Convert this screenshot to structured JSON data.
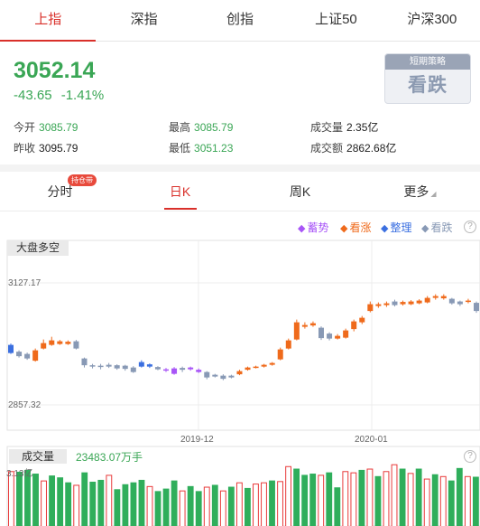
{
  "market_tabs": [
    "上指",
    "深指",
    "创指",
    "上证50",
    "沪深300"
  ],
  "quote": {
    "price": "3052.14",
    "change": "-43.65",
    "change_pct": "-1.41%",
    "open_label": "今开",
    "open": "3085.79",
    "prev_close_label": "昨收",
    "prev_close": "3095.79",
    "high_label": "最高",
    "high": "3085.79",
    "low_label": "最低",
    "low": "3051.23",
    "volume_label": "成交量",
    "volume": "2.35亿",
    "turnover_label": "成交额",
    "turnover": "2862.68亿"
  },
  "strategy": {
    "title": "短期策略",
    "value": "看跌"
  },
  "chart_tabs": {
    "items": [
      "分时",
      "日K",
      "周K",
      "更多"
    ],
    "badge": "持仓带"
  },
  "legend": [
    {
      "label": "蓄势",
      "color": "#a855f7"
    },
    {
      "label": "看涨",
      "color": "#ef6a1b"
    },
    {
      "label": "整理",
      "color": "#3b6fe0"
    },
    {
      "label": "看跌",
      "color": "#8899b5"
    }
  ],
  "kline": {
    "panel_label": "大盘多空",
    "y_top_label": "3127.17",
    "y_bottom_label": "2857.32",
    "x_labels": [
      "2019-12",
      "2020-01"
    ]
  },
  "volume": {
    "title": "成交量",
    "value": "23483.07万手",
    "max_label": "3.13亿"
  },
  "chart_data": {
    "type": "candlestick",
    "ylim": [
      2857.32,
      3127.17
    ],
    "candles": [
      {
        "o": 2972,
        "c": 2990,
        "h": 2993,
        "l": 2970,
        "s": "z"
      },
      {
        "o": 2965,
        "c": 2975,
        "h": 2978,
        "l": 2962,
        "s": "d"
      },
      {
        "o": 2970,
        "c": 2960,
        "h": 2973,
        "l": 2957,
        "s": "d"
      },
      {
        "o": 2955,
        "c": 2978,
        "h": 2982,
        "l": 2953,
        "s": "k"
      },
      {
        "o": 2982,
        "c": 2994,
        "h": 3002,
        "l": 2980,
        "s": "k"
      },
      {
        "o": 2990,
        "c": 3000,
        "h": 3008,
        "l": 2988,
        "s": "k"
      },
      {
        "o": 2998,
        "c": 2992,
        "h": 3001,
        "l": 2990,
        "s": "k"
      },
      {
        "o": 2992,
        "c": 2997,
        "h": 3000,
        "l": 2990,
        "s": "k"
      },
      {
        "o": 2998,
        "c": 2982,
        "h": 3001,
        "l": 2980,
        "s": "d"
      },
      {
        "o": 2960,
        "c": 2945,
        "h": 2962,
        "l": 2940,
        "s": "d"
      },
      {
        "o": 2945,
        "c": 2942,
        "h": 2948,
        "l": 2938,
        "s": "d"
      },
      {
        "o": 2944,
        "c": 2941,
        "h": 2948,
        "l": 2936,
        "s": "d"
      },
      {
        "o": 2942,
        "c": 2946,
        "h": 2950,
        "l": 2939,
        "s": "d"
      },
      {
        "o": 2945,
        "c": 2938,
        "h": 2947,
        "l": 2935,
        "s": "d"
      },
      {
        "o": 2944,
        "c": 2937,
        "h": 2946,
        "l": 2933,
        "s": "d"
      },
      {
        "o": 2940,
        "c": 2930,
        "h": 2943,
        "l": 2928,
        "s": "d"
      },
      {
        "o": 2952,
        "c": 2942,
        "h": 2956,
        "l": 2940,
        "s": "z"
      },
      {
        "o": 2947,
        "c": 2942,
        "h": 2949,
        "l": 2939,
        "s": "z"
      },
      {
        "o": 2941,
        "c": 2936,
        "h": 2943,
        "l": 2934,
        "s": "d"
      },
      {
        "o": 2936,
        "c": 2933,
        "h": 2939,
        "l": 2930,
        "s": "x"
      },
      {
        "o": 2938,
        "c": 2926,
        "h": 2941,
        "l": 2924,
        "s": "x"
      },
      {
        "o": 2939,
        "c": 2935,
        "h": 2942,
        "l": 2930,
        "s": "d"
      },
      {
        "o": 2940,
        "c": 2936,
        "h": 2942,
        "l": 2933,
        "s": "x"
      },
      {
        "o": 2935,
        "c": 2930,
        "h": 2938,
        "l": 2928,
        "s": "x"
      },
      {
        "o": 2930,
        "c": 2918,
        "h": 2932,
        "l": 2914,
        "s": "d"
      },
      {
        "o": 2924,
        "c": 2920,
        "h": 2926,
        "l": 2918,
        "s": "d"
      },
      {
        "o": 2922,
        "c": 2915,
        "h": 2925,
        "l": 2912,
        "s": "d"
      },
      {
        "o": 2918,
        "c": 2922,
        "h": 2924,
        "l": 2916,
        "s": "d"
      },
      {
        "o": 2925,
        "c": 2932,
        "h": 2935,
        "l": 2923,
        "s": "k"
      },
      {
        "o": 2935,
        "c": 2940,
        "h": 2942,
        "l": 2933,
        "s": "k"
      },
      {
        "o": 2940,
        "c": 2942,
        "h": 2944,
        "l": 2938,
        "s": "k"
      },
      {
        "o": 2942,
        "c": 2946,
        "h": 2948,
        "l": 2940,
        "s": "k"
      },
      {
        "o": 2946,
        "c": 2950,
        "h": 2952,
        "l": 2944,
        "s": "k"
      },
      {
        "o": 2958,
        "c": 2980,
        "h": 2984,
        "l": 2956,
        "s": "k"
      },
      {
        "o": 2982,
        "c": 3000,
        "h": 3004,
        "l": 2980,
        "s": "k"
      },
      {
        "o": 3002,
        "c": 3040,
        "h": 3046,
        "l": 3000,
        "s": "k"
      },
      {
        "o": 3034,
        "c": 3030,
        "h": 3040,
        "l": 3026,
        "s": "k"
      },
      {
        "o": 3038,
        "c": 3033,
        "h": 3042,
        "l": 3030,
        "s": "k"
      },
      {
        "o": 3028,
        "c": 3005,
        "h": 3031,
        "l": 3001,
        "s": "d"
      },
      {
        "o": 3015,
        "c": 3004,
        "h": 3018,
        "l": 3000,
        "s": "d"
      },
      {
        "o": 3004,
        "c": 3010,
        "h": 3014,
        "l": 3002,
        "s": "k"
      },
      {
        "o": 3006,
        "c": 3022,
        "h": 3026,
        "l": 3004,
        "s": "k"
      },
      {
        "o": 3025,
        "c": 3042,
        "h": 3046,
        "l": 3020,
        "s": "k"
      },
      {
        "o": 3040,
        "c": 3050,
        "h": 3054,
        "l": 3036,
        "s": "k"
      },
      {
        "o": 3065,
        "c": 3080,
        "h": 3086,
        "l": 3062,
        "s": "k"
      },
      {
        "o": 3076,
        "c": 3080,
        "h": 3084,
        "l": 3072,
        "s": "k"
      },
      {
        "o": 3078,
        "c": 3082,
        "h": 3086,
        "l": 3074,
        "s": "k"
      },
      {
        "o": 3086,
        "c": 3078,
        "h": 3090,
        "l": 3075,
        "s": "d"
      },
      {
        "o": 3080,
        "c": 3085,
        "h": 3088,
        "l": 3077,
        "s": "k"
      },
      {
        "o": 3080,
        "c": 3086,
        "h": 3089,
        "l": 3078,
        "s": "k"
      },
      {
        "o": 3082,
        "c": 3088,
        "h": 3091,
        "l": 3080,
        "s": "k"
      },
      {
        "o": 3084,
        "c": 3094,
        "h": 3098,
        "l": 3082,
        "s": "k"
      },
      {
        "o": 3094,
        "c": 3098,
        "h": 3102,
        "l": 3090,
        "s": "k"
      },
      {
        "o": 3098,
        "c": 3093,
        "h": 3102,
        "l": 3090,
        "s": "k"
      },
      {
        "o": 3092,
        "c": 3082,
        "h": 3094,
        "l": 3079,
        "s": "d"
      },
      {
        "o": 3086,
        "c": 3080,
        "h": 3088,
        "l": 3076,
        "s": "d"
      },
      {
        "o": 3088,
        "c": 3085,
        "h": 3092,
        "l": 3082,
        "s": "k"
      },
      {
        "o": 3083,
        "c": 3065,
        "h": 3086,
        "l": 3061,
        "s": "d"
      }
    ],
    "volume": [
      {
        "v": 0.88,
        "d": 0
      },
      {
        "v": 0.87,
        "d": 1
      },
      {
        "v": 0.9,
        "d": 1
      },
      {
        "v": 0.84,
        "d": 1
      },
      {
        "v": 0.73,
        "d": 0
      },
      {
        "v": 0.81,
        "d": 1
      },
      {
        "v": 0.78,
        "d": 1
      },
      {
        "v": 0.7,
        "d": 1
      },
      {
        "v": 0.66,
        "d": 0
      },
      {
        "v": 0.86,
        "d": 1
      },
      {
        "v": 0.71,
        "d": 1
      },
      {
        "v": 0.74,
        "d": 1
      },
      {
        "v": 0.82,
        "d": 0
      },
      {
        "v": 0.59,
        "d": 1
      },
      {
        "v": 0.67,
        "d": 1
      },
      {
        "v": 0.7,
        "d": 1
      },
      {
        "v": 0.74,
        "d": 1
      },
      {
        "v": 0.64,
        "d": 0
      },
      {
        "v": 0.56,
        "d": 1
      },
      {
        "v": 0.6,
        "d": 1
      },
      {
        "v": 0.73,
        "d": 1
      },
      {
        "v": 0.57,
        "d": 0
      },
      {
        "v": 0.64,
        "d": 1
      },
      {
        "v": 0.56,
        "d": 1
      },
      {
        "v": 0.63,
        "d": 0
      },
      {
        "v": 0.66,
        "d": 1
      },
      {
        "v": 0.57,
        "d": 0
      },
      {
        "v": 0.63,
        "d": 1
      },
      {
        "v": 0.7,
        "d": 0
      },
      {
        "v": 0.61,
        "d": 1
      },
      {
        "v": 0.68,
        "d": 0
      },
      {
        "v": 0.7,
        "d": 0
      },
      {
        "v": 0.73,
        "d": 1
      },
      {
        "v": 0.72,
        "d": 0
      },
      {
        "v": 0.96,
        "d": 0
      },
      {
        "v": 0.92,
        "d": 1
      },
      {
        "v": 0.82,
        "d": 1
      },
      {
        "v": 0.84,
        "d": 1
      },
      {
        "v": 0.82,
        "d": 0
      },
      {
        "v": 0.86,
        "d": 1
      },
      {
        "v": 0.62,
        "d": 1
      },
      {
        "v": 0.88,
        "d": 0
      },
      {
        "v": 0.86,
        "d": 0
      },
      {
        "v": 0.9,
        "d": 1
      },
      {
        "v": 0.92,
        "d": 0
      },
      {
        "v": 0.8,
        "d": 1
      },
      {
        "v": 0.88,
        "d": 0
      },
      {
        "v": 0.99,
        "d": 0
      },
      {
        "v": 0.92,
        "d": 1
      },
      {
        "v": 0.85,
        "d": 0
      },
      {
        "v": 0.92,
        "d": 1
      },
      {
        "v": 0.76,
        "d": 0
      },
      {
        "v": 0.83,
        "d": 1
      },
      {
        "v": 0.8,
        "d": 0
      },
      {
        "v": 0.73,
        "d": 1
      },
      {
        "v": 0.93,
        "d": 1
      },
      {
        "v": 0.8,
        "d": 0
      },
      {
        "v": 0.79,
        "d": 1
      }
    ]
  }
}
